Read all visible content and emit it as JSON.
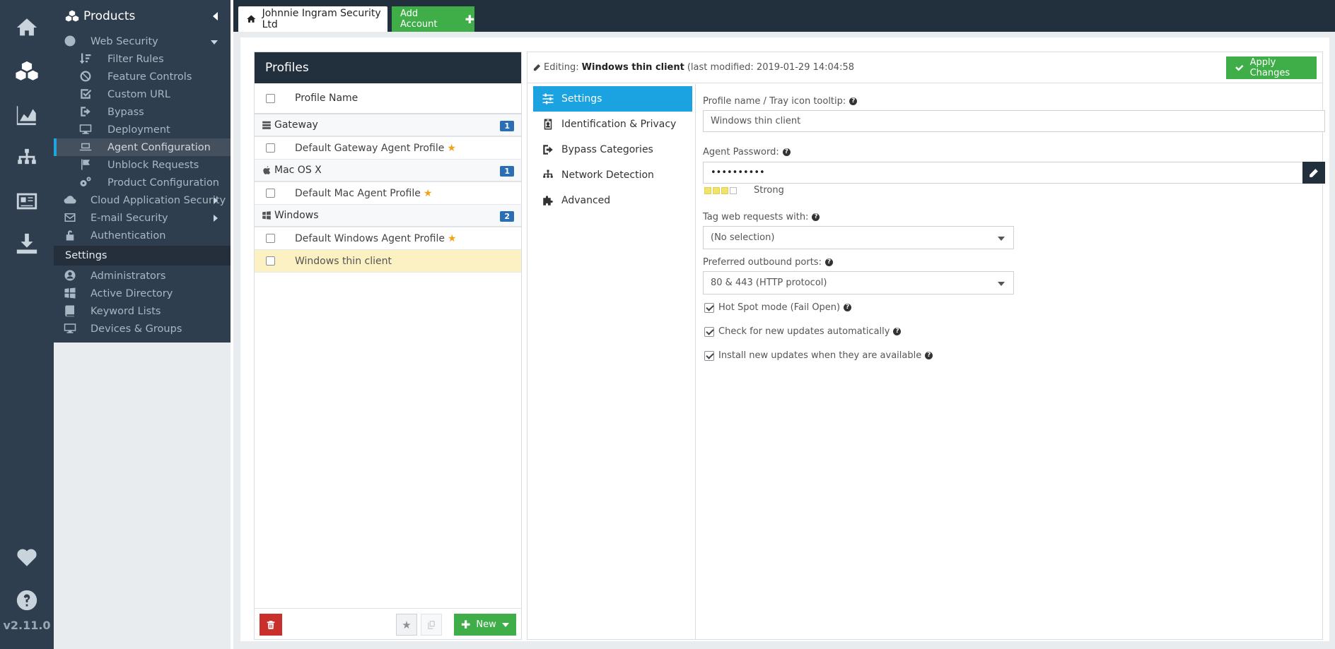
{
  "version": "v2.11.0",
  "nav": {
    "header": "Products",
    "items": [
      {
        "label": "Web Security",
        "level": 1
      },
      {
        "label": "Filter Rules",
        "level": 2
      },
      {
        "label": "Feature Controls",
        "level": 2
      },
      {
        "label": "Custom URL",
        "level": 2
      },
      {
        "label": "Bypass",
        "level": 2
      },
      {
        "label": "Deployment",
        "level": 2
      },
      {
        "label": "Agent Configuration",
        "level": 2
      },
      {
        "label": "Unblock Requests",
        "level": 2
      },
      {
        "label": "Product Configuration",
        "level": 2
      },
      {
        "label": "Cloud Application Security",
        "level": 1
      },
      {
        "label": "E-mail Security",
        "level": 1
      },
      {
        "label": "Authentication",
        "level": 1
      }
    ],
    "settings_header": "Settings",
    "settings_items": [
      {
        "label": "Administrators"
      },
      {
        "label": "Active Directory"
      },
      {
        "label": "Keyword Lists"
      },
      {
        "label": "Devices & Groups"
      }
    ]
  },
  "topbar": {
    "account_tab": "Johnnie Ingram Security Ltd",
    "add_account": "Add Account"
  },
  "profiles": {
    "title": "Profiles",
    "column_header": "Profile Name",
    "groups": [
      {
        "name": "Gateway",
        "count": "1",
        "profiles": [
          {
            "name": "Default Gateway Agent Profile",
            "default": true
          }
        ]
      },
      {
        "name": "Mac OS X",
        "count": "1",
        "profiles": [
          {
            "name": "Default Mac Agent Profile",
            "default": true
          }
        ]
      },
      {
        "name": "Windows",
        "count": "2",
        "profiles": [
          {
            "name": "Default Windows Agent Profile",
            "default": true
          },
          {
            "name": "Windows thin client",
            "default": false
          }
        ]
      }
    ],
    "new_button": "New"
  },
  "editor": {
    "editing_prefix": "Editing:",
    "profile_name": "Windows thin client",
    "last_modified": "(last modified: 2019-01-29 14:04:58",
    "apply_button": "Apply Changes",
    "tabs": [
      {
        "label": "Settings"
      },
      {
        "label": "Identification & Privacy"
      },
      {
        "label": "Bypass Categories"
      },
      {
        "label": "Network Detection"
      },
      {
        "label": "Advanced"
      }
    ],
    "form": {
      "profile_name_label": "Profile name / Tray icon tooltip:",
      "profile_name_value": "Windows thin client",
      "password_label": "Agent Password:",
      "password_value": "••••••••••",
      "strength_text": "Strong",
      "tag_label": "Tag web requests with:",
      "tag_value": "(No selection)",
      "ports_label": "Preferred outbound ports:",
      "ports_value": "80 & 443 (HTTP protocol)",
      "hotspot_label": "Hot Spot mode (Fail Open)",
      "check_updates_label": "Check for new updates automatically",
      "install_updates_label": "Install new updates when they are available"
    }
  },
  "colors": {
    "rail_bg": "#2f3e4e",
    "topbar_bg": "#222f3c",
    "accent_blue": "#1aa3e0",
    "green": "#3fae49",
    "danger": "#c9302c",
    "badge": "#2a6fb3",
    "selected_row": "#fcf1c3"
  }
}
